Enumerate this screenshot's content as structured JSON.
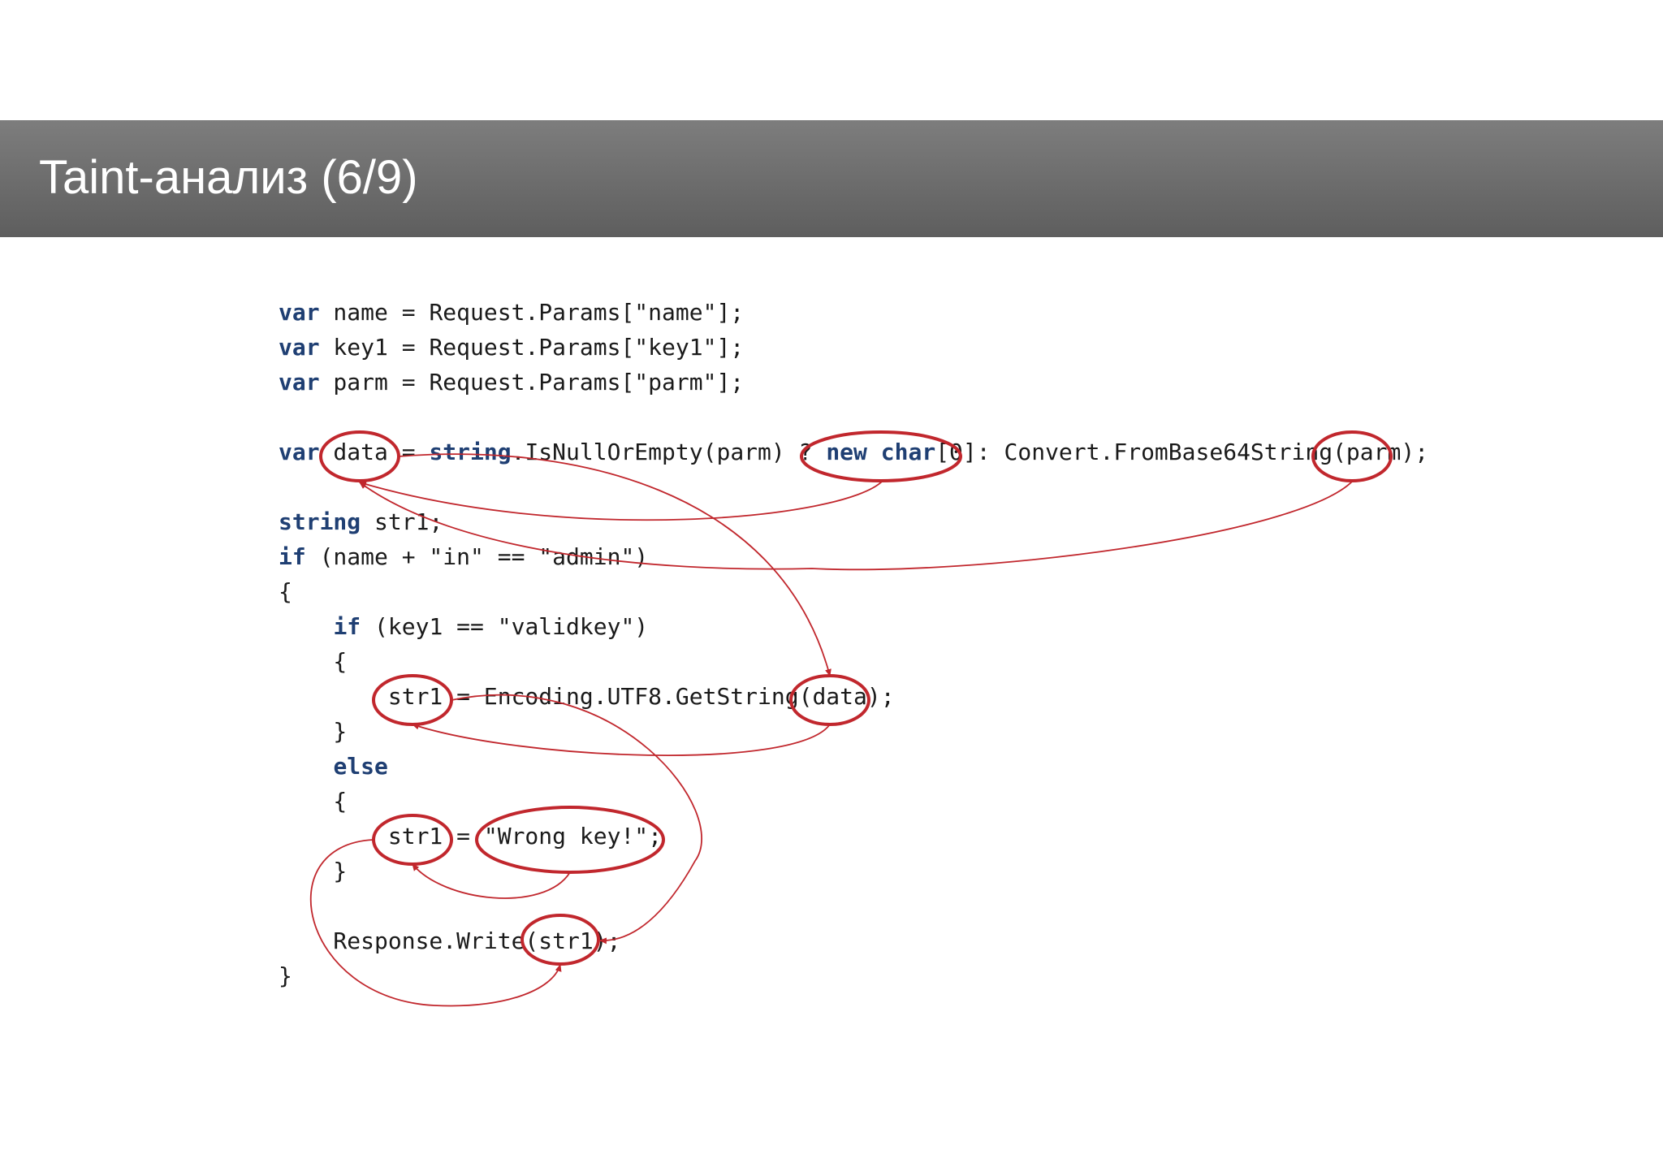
{
  "slide": {
    "title": "Taint-анализ (6/9)"
  },
  "colors": {
    "keyword": "#1f3f73",
    "code_text": "#1a1a1a",
    "annotation": "#c1272d",
    "title_bar": "#6c6c6c",
    "title_text": "#ffffff"
  },
  "code_lines": [
    [
      {
        "t": "var",
        "k": 1
      },
      {
        "t": " name = Request.Params[\"name\"];"
      }
    ],
    [
      {
        "t": "var",
        "k": 1
      },
      {
        "t": " key1 = Request.Params[\"key1\"];"
      }
    ],
    [
      {
        "t": "var",
        "k": 1
      },
      {
        "t": " parm = Request.Params[\"parm\"];"
      }
    ],
    [],
    [
      {
        "t": "var",
        "k": 1
      },
      {
        "t": " data = "
      },
      {
        "t": "string",
        "k": 1
      },
      {
        "t": ".IsNullOrEmpty(parm) ? "
      },
      {
        "t": "new",
        "k": 1
      },
      {
        "t": " "
      },
      {
        "t": "char",
        "k": 1
      },
      {
        "t": "[0]: Convert.FromBase64String(parm);"
      }
    ],
    [],
    [
      {
        "t": "string",
        "k": 1
      },
      {
        "t": " str1;"
      }
    ],
    [
      {
        "t": "if",
        "k": 1
      },
      {
        "t": " (name + \"in\" == \"admin\")"
      }
    ],
    [
      {
        "t": "{"
      }
    ],
    [
      {
        "t": "    "
      },
      {
        "t": "if",
        "k": 1
      },
      {
        "t": " (key1 == \"validkey\")"
      }
    ],
    [
      {
        "t": "    {"
      }
    ],
    [
      {
        "t": "        str1 = Encoding.UTF8.GetString(data);"
      }
    ],
    [
      {
        "t": "    }"
      }
    ],
    [
      {
        "t": "    "
      },
      {
        "t": "else",
        "k": 1
      }
    ],
    [
      {
        "t": "    {"
      }
    ],
    [
      {
        "t": "        str1 = \"Wrong key!\";"
      }
    ],
    [
      {
        "t": "    }"
      }
    ],
    [],
    [
      {
        "t": "    Response.Write(str1);"
      }
    ],
    [
      {
        "t": "}"
      }
    ]
  ]
}
